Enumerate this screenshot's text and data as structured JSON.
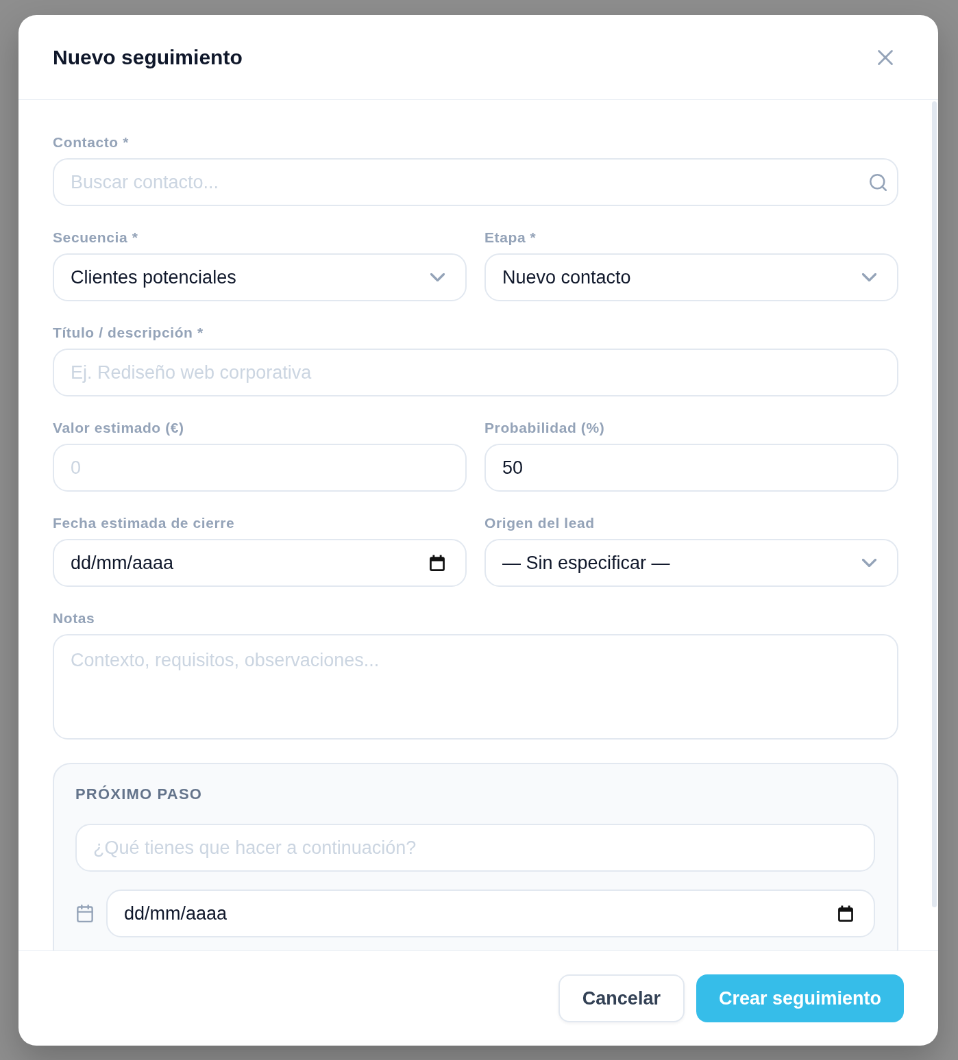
{
  "dialog": {
    "title": "Nuevo seguimiento"
  },
  "form": {
    "rows": [
      {
        "fields": [
          {
            "kind": "search",
            "label": "Contacto *",
            "placeholder": "Buscar contacto..."
          }
        ]
      },
      {
        "fields": [
          {
            "kind": "select",
            "label": "Secuencia *",
            "value": "Clientes potenciales"
          },
          {
            "kind": "select",
            "label": "Etapa *",
            "value": "Nuevo contacto"
          }
        ]
      },
      {
        "fields": [
          {
            "kind": "text",
            "label": "Título / descripción *",
            "placeholder": "Ej. Rediseño web corporativa"
          }
        ]
      },
      {
        "fields": [
          {
            "kind": "text",
            "label": "Valor estimado (€)",
            "placeholder": "0"
          },
          {
            "kind": "text",
            "label": "Probabilidad (%)",
            "value": "50"
          }
        ]
      },
      {
        "fields": [
          {
            "kind": "date",
            "label": "Fecha estimada de cierre",
            "placeholder": "dd/mm/aaaa"
          },
          {
            "kind": "select",
            "label": "Origen del lead",
            "value": "— Sin especificar —"
          }
        ]
      },
      {
        "fields": [
          {
            "kind": "textarea",
            "label": "Notas",
            "placeholder": "Contexto, requisitos, observaciones..."
          }
        ]
      }
    ]
  },
  "next_step": {
    "title": "PRÓXIMO PASO",
    "task": {
      "placeholder": "¿Qué tienes que hacer a continuación?"
    },
    "due_date": {
      "placeholder": "dd/mm/aaaa"
    }
  },
  "footer": {
    "buttons": [
      {
        "kind": "secondary",
        "label": "Cancelar"
      },
      {
        "kind": "primary",
        "label": "Crear seguimiento"
      }
    ]
  }
}
